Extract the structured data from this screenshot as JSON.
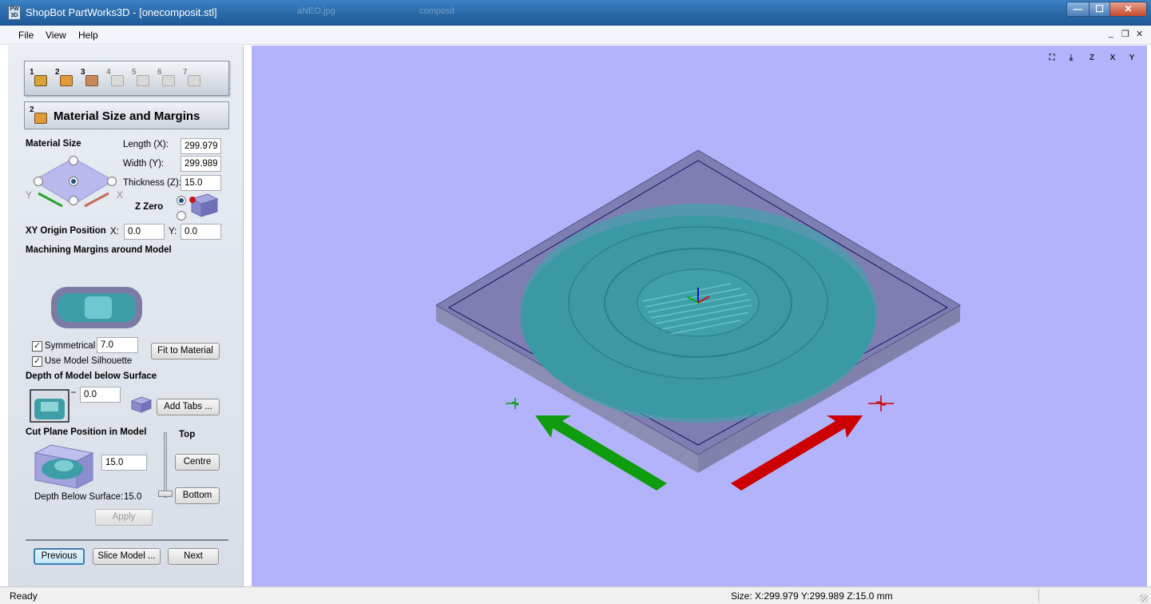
{
  "window": {
    "title": "ShopBot PartWorks3D - [onecomposit.stl]",
    "icon_text": "PW 3D",
    "ghost_tab_1": "aNEO.jpg",
    "ghost_tab_2": "composit",
    "controls": {
      "minimize": "—",
      "maximize": "☐",
      "close": "✕"
    }
  },
  "menu": {
    "items": [
      {
        "label": "File"
      },
      {
        "label": "View"
      },
      {
        "label": "Help"
      }
    ],
    "mdi": {
      "minimize": "_",
      "restore": "❐",
      "close": "✕"
    }
  },
  "steps": {
    "buttons": [
      {
        "num": "1",
        "icon": "material-block-icon",
        "color": "#d8a236"
      },
      {
        "num": "2",
        "icon": "material-size-icon",
        "color": "#e09a3a"
      },
      {
        "num": "3",
        "icon": "orientation-icon",
        "color": "#c98a5a"
      },
      {
        "num": "4",
        "icon": "slice-icon",
        "color": "#c9c9c9"
      },
      {
        "num": "5",
        "icon": "toolpath-icon",
        "color": "#c9c9c9"
      },
      {
        "num": "6",
        "icon": "preview-icon",
        "color": "#c9c9c9"
      },
      {
        "num": "7",
        "icon": "save-icon",
        "color": "#c9c9c9"
      }
    ]
  },
  "panel": {
    "section_number": "2",
    "section_title": "Material Size and Margins",
    "material_size_label": "Material Size",
    "length_label": "Length (X):",
    "length_value": "299.979",
    "width_label": "Width (Y):",
    "width_value": "299.989",
    "thickness_label": "Thickness (Z):",
    "thickness_value": "15.0",
    "z_zero_label": "Z Zero",
    "axis_y": "Y",
    "axis_x": "X",
    "xy_origin_label": "XY Origin Position",
    "origin_x_label": "X:",
    "origin_x_value": "0.0",
    "origin_y_label": "Y:",
    "origin_y_value": "0.0",
    "margins_label": "Machining Margins around Model",
    "symmetrical_label": "Symmetrical",
    "symmetrical_checked": "✓",
    "margin_value": "7.0",
    "fit_button": "Fit to Material",
    "silhouette_label": "Use Model Silhouette",
    "silhouette_checked": "✓",
    "depth_label": "Depth of Model below Surface",
    "depth_value": "0.0",
    "add_tabs_button": "Add Tabs ...",
    "cut_plane_label": "Cut Plane Position in Model",
    "cut_plane_value": "15.0",
    "top_label": "Top",
    "centre_button": "Centre",
    "bottom_button": "Bottom",
    "depth_below_label": "Depth Below Surface:",
    "depth_below_value": "15.0",
    "apply_button": "Apply",
    "previous_button": "Previous",
    "slice_button": "Slice Model ...",
    "next_button": "Next"
  },
  "viewport": {
    "background": "#b3b3fb",
    "view_icons": [
      {
        "name": "zoom-extents-icon",
        "glyph": "⛶"
      },
      {
        "name": "iso-view-icon",
        "glyph": "⤓"
      },
      {
        "name": "view-z-icon",
        "glyph": "Z"
      },
      {
        "name": "view-x-icon",
        "glyph": "X"
      },
      {
        "name": "view-y-icon",
        "glyph": "Y"
      }
    ],
    "colors": {
      "material": "#7b7ba6",
      "model": "#3e9ea8",
      "x_arrow": "#cc0000",
      "y_arrow": "#0f9c0f"
    }
  },
  "status": {
    "ready": "Ready",
    "size": "Size: X:299.979 Y:299.989 Z:15.0 mm"
  }
}
